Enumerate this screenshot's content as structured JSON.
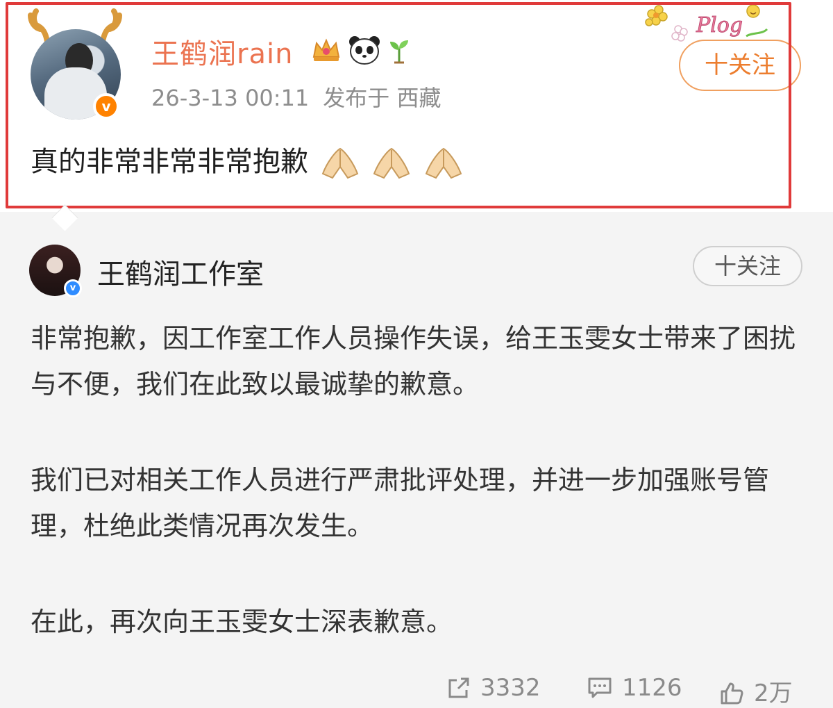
{
  "post": {
    "username": "王鹤润rain",
    "timestamp": "26-3-13 00:11",
    "location": "发布于 西藏",
    "text": "真的非常非常非常抱歉",
    "follow_label": "十关注",
    "user_badges": [
      "crown-icon",
      "panda-icon",
      "sprout-icon"
    ],
    "verified_color": "#ff8200",
    "highlight_color": "#e03a3a",
    "sticker_text": "Plog"
  },
  "repost": {
    "author": "王鹤润工作室",
    "follow_label": "十关注",
    "paragraph1": "非常抱歉，因工作室工作人员操作失误，给王玉雯女士带来了困扰与不便，我们在此致以最诚挚的歉意。",
    "paragraph2": "我们已对相关工作人员进行严肃批评处理，并进一步加强账号管理，杜绝此类情况再次发生。",
    "paragraph3": "在此，再次向王玉雯女士深表歉意。",
    "verified_color": "#2f8cff"
  },
  "stats": {
    "reposts": "3332",
    "comments": "1126",
    "likes": "2万"
  }
}
